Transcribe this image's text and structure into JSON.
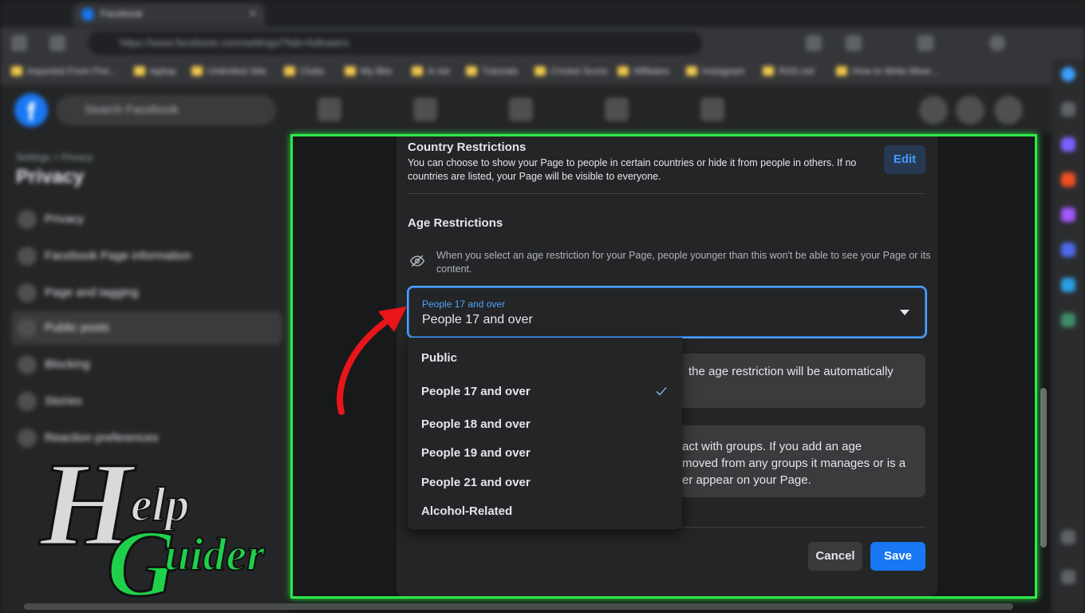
{
  "browser": {
    "tab_title": "Facebook",
    "url": "https://www.facebook.com/settings/?tab=followers",
    "bookmarks": [
      "Imported From Fire...",
      "laptop",
      "Unlimited Site",
      "Clubs",
      "My Bits",
      "A.net",
      "Tutorials",
      "Cricket Score",
      "Affiliates",
      "Instagram",
      "RSS.net",
      "How to Write Mear..."
    ]
  },
  "fb_header": {
    "logo": "f",
    "search_placeholder": "Search Facebook"
  },
  "sidebar": {
    "breadcrumb": "Settings > Privacy",
    "title": "Privacy",
    "items": [
      {
        "label": "Privacy"
      },
      {
        "label": "Facebook Page information"
      },
      {
        "label": "Page and tagging"
      },
      {
        "label": "Public posts"
      },
      {
        "label": "Blocking"
      },
      {
        "label": "Stories"
      },
      {
        "label": "Reaction preferences"
      }
    ]
  },
  "country": {
    "title": "Country Restrictions",
    "desc": "You can choose to show your Page to people in certain countries or hide it from people in others. If no countries are listed, your Page will be visible to everyone.",
    "edit_label": "Edit"
  },
  "age": {
    "title": "Age Restrictions",
    "info": "When you select an age restriction for your Page, people younger than this won't be able to see your Page or its content.",
    "select_label": "People 17 and over",
    "select_value": "People 17 and over",
    "note1": "the age restriction will be automatically",
    "note2_line1": "act with groups. If you add an age",
    "note2_line2": "moved from any groups it manages or is a",
    "note2_line3": "er appear on your Page."
  },
  "dropdown": {
    "options": [
      "Public",
      "People 17 and over",
      "People 18 and over",
      "People 19 and over",
      "People 21 and over",
      "Alcohol-Related"
    ],
    "selected": "People 17 and over"
  },
  "footer": {
    "cancel_label": "Cancel",
    "save_label": "Save"
  },
  "watermark": {
    "text": "Help Guider"
  },
  "colors": {
    "accent": "#1877f2",
    "focus": "#4da3ff",
    "highlight_frame": "#2ee84a",
    "arrow": "#e8151b"
  }
}
